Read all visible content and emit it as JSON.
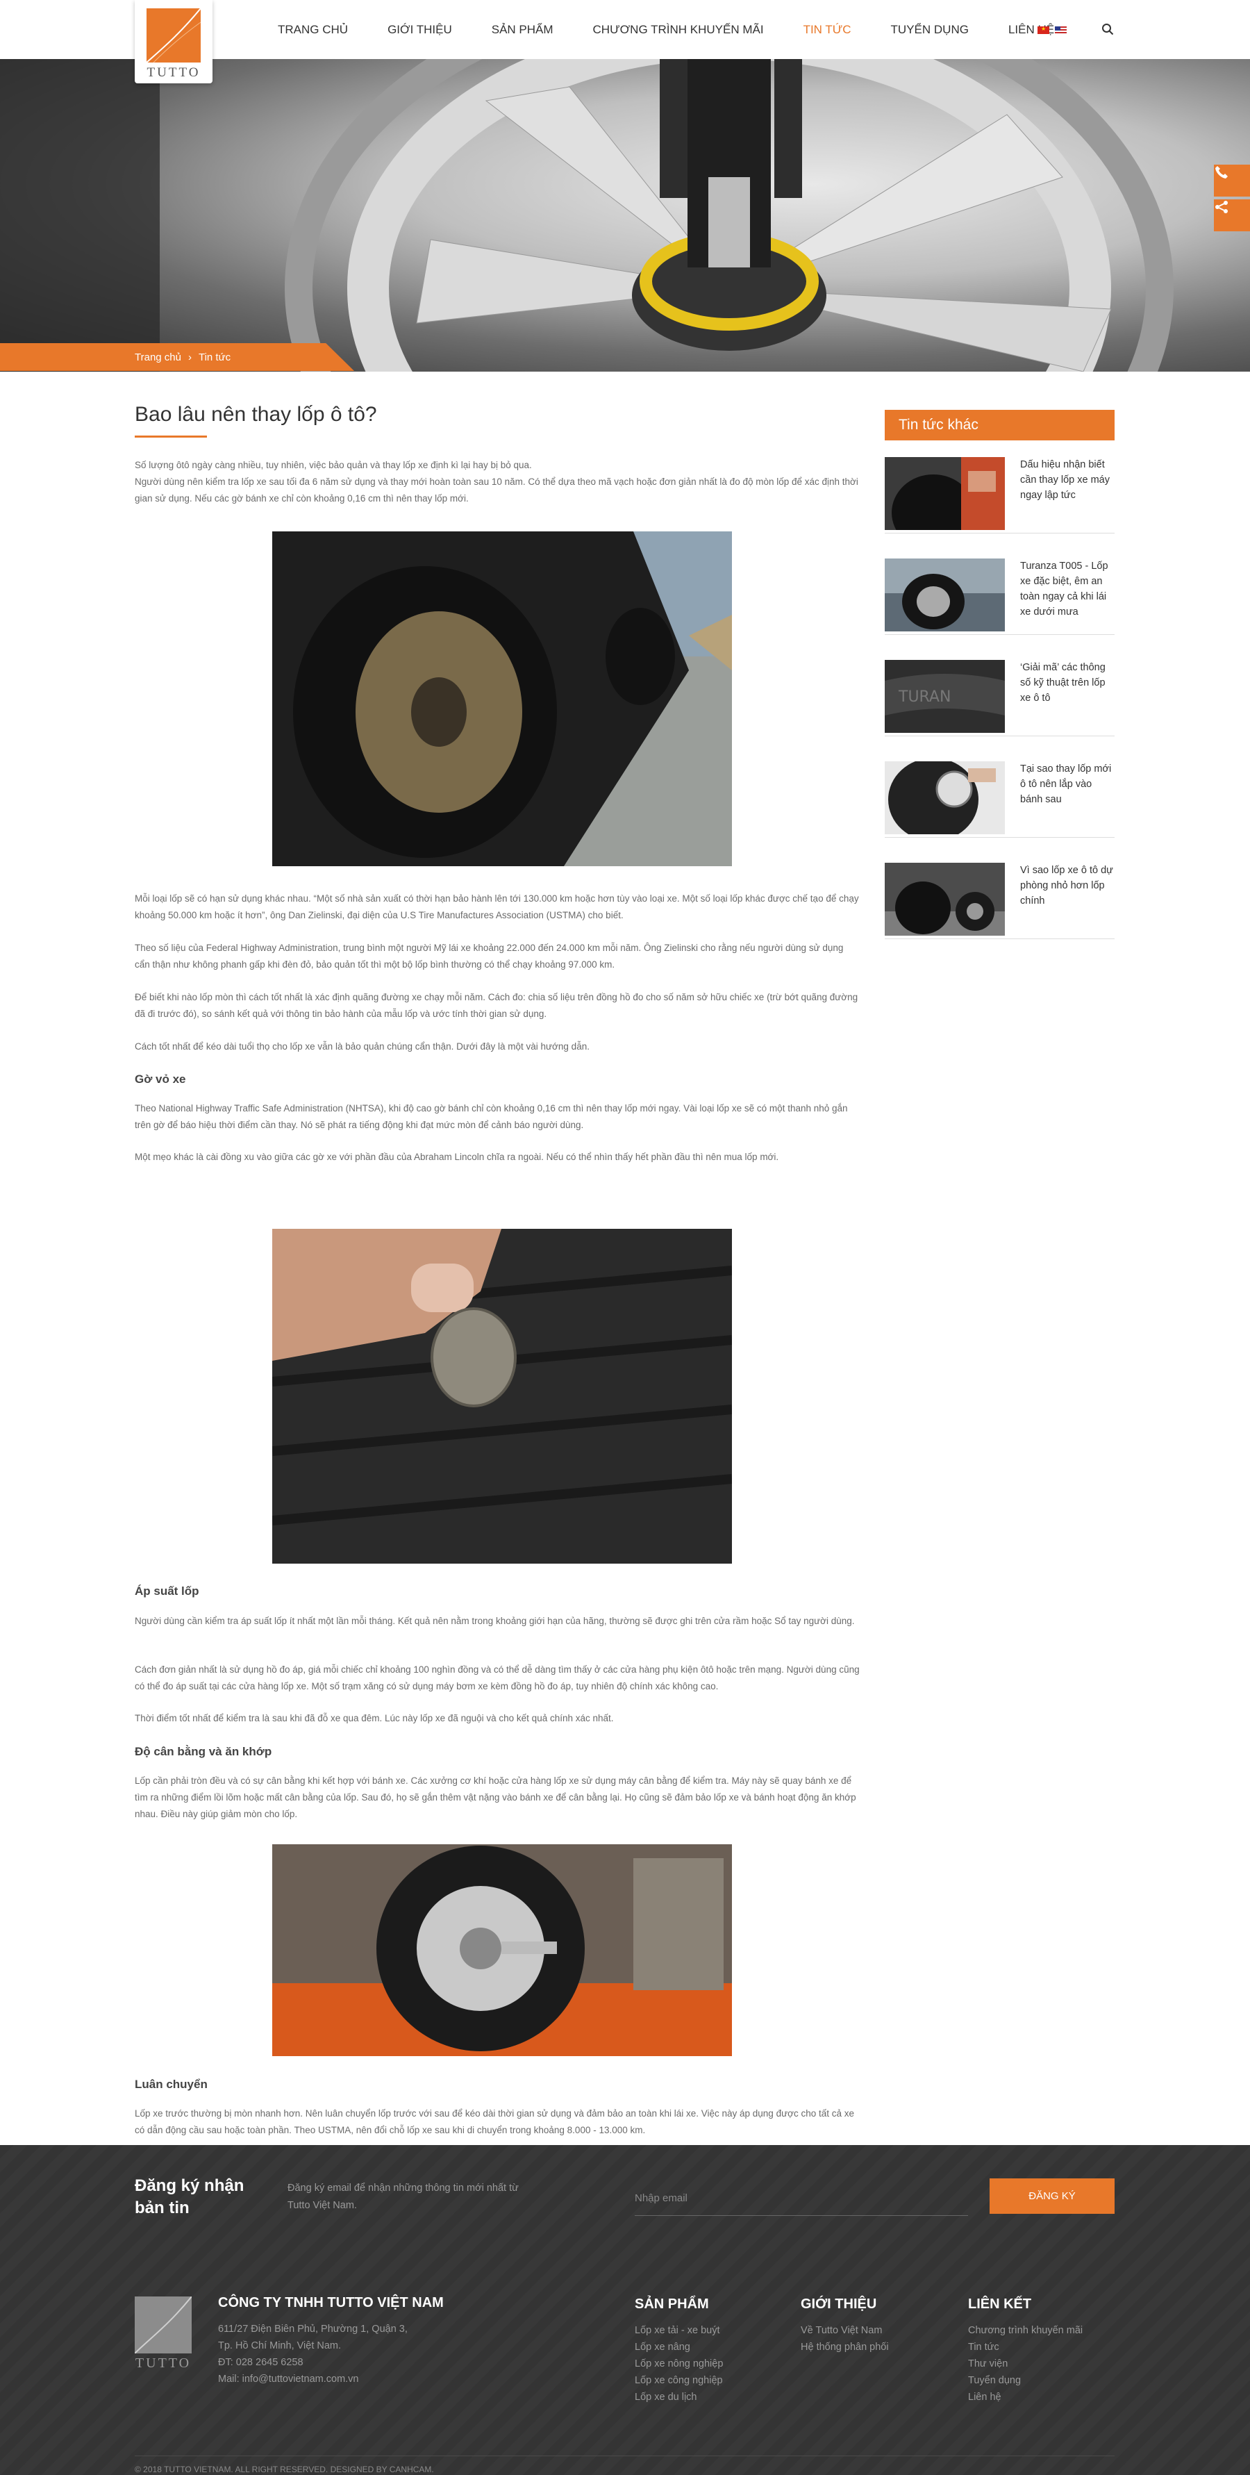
{
  "header": {
    "logo_text": "TUTTO",
    "nav": [
      {
        "label": "Trang chủ",
        "active": false
      },
      {
        "label": "Giới thiệu",
        "active": false
      },
      {
        "label": "Sản phẩm",
        "active": false
      },
      {
        "label": "Chương trình khuyến mãi",
        "active": false
      },
      {
        "label": "Tin tức",
        "active": true
      },
      {
        "label": "Tuyển dụng",
        "active": false
      },
      {
        "label": "Liên hệ",
        "active": false
      }
    ],
    "languages": [
      "vi",
      "en"
    ],
    "icons": {
      "search": "search-icon",
      "phone": "phone-icon",
      "share": "share-icon"
    }
  },
  "breadcrumb": {
    "home": "Trang chủ",
    "separator": "›",
    "current": "Tin tức"
  },
  "article": {
    "title": "Bao lâu nên thay lốp ô tô?",
    "intro": [
      "Số lượng ôtô ngày càng nhiều, tuy nhiên, việc bảo quản và thay lốp xe định kì lại hay bị bỏ qua.",
      "Người dùng nên kiểm tra lốp xe sau tối đa 6 năm sử dụng và thay mới hoàn toàn sau 10 năm. Có thể dựa theo mã vạch hoặc đơn giản nhất là đo độ mòn lốp để xác định thời gian sử dụng. Nếu các gờ bánh xe chỉ còn khoảng 0,16 cm thì nên thay lốp mới."
    ],
    "p1": "Mỗi loại lốp sẽ có hạn sử dụng khác nhau. “Một số nhà sản xuất có thời hạn bảo hành lên tới 130.000 km hoặc hơn tùy vào loại xe. Một số loại lốp khác được chế tạo để chạy khoảng 50.000 km hoặc ít hơn”, ông Dan Zielinski, đại diện của U.S Tire Manufactures Association (USTMA) cho biết.",
    "p2": "Theo số liệu của Federal Highway Administration, trung bình một người Mỹ lái xe khoảng 22.000 đến 24.000 km mỗi năm. Ông Zielinski cho rằng nếu người dùng sử dụng cẩn thận như không phanh gấp khi đèn đỏ, bảo quản tốt thì một bộ lốp bình thường có thể chạy khoảng 97.000 km.",
    "p3": "Để biết khi nào lốp mòn thì cách tốt nhất là xác định quãng đường xe chạy mỗi năm. Cách đo: chia số liệu trên đồng hồ đo cho số năm sở hữu chiếc xe (trừ bớt quãng đường đã đi trước đó), so sánh kết quả với thông tin bảo hành của mẫu lốp và ước tính thời gian sử dụng.",
    "p4": "Cách tốt nhất để kéo dài tuổi thọ cho lốp xe vẫn là bảo quản chúng cẩn thận. Dưới đây là một vài hướng dẫn.",
    "h_tread": "Gờ vỏ xe",
    "p5": "Theo National Highway Traffic Safe Administration (NHTSA), khi độ cao gờ bánh chỉ còn khoảng 0,16 cm thì nên thay lốp mới ngay. Vài loại lốp xe sẽ có một thanh nhỏ gắn trên gờ để báo hiệu thời điểm cần thay. Nó sẽ phát ra tiếng động khi đạt mức mòn để cảnh báo người dùng.",
    "p6": "Một mẹo khác là cài đồng xu vào giữa các gờ xe với phần đầu của Abraham Lincoln chĩa ra ngoài. Nếu có thể nhìn thấy hết phần đầu thì nên mua lốp mới.",
    "h_pressure": "Áp suất lốp",
    "p7": "Người dùng cần kiểm tra áp suất lốp ít nhất một lần mỗi tháng. Kết quả nên nằm trong khoảng giới hạn của hãng, thường sẽ được ghi trên cửa rầm hoặc Sổ tay người dùng.",
    "p8": "Cách đơn giản nhất là sử dụng hồ đo áp, giá mỗi chiếc chỉ khoảng 100 nghìn đồng và có thể dễ dàng tìm thấy ở các cửa hàng phụ kiện ôtô hoặc trên mạng. Người dùng cũng có thể đo áp suất tại các cửa hàng lốp xe. Một số trạm xăng có sử dụng máy bơm xe kèm đồng hồ đo áp, tuy nhiên độ chính xác không cao.",
    "p9": "Thời điểm tốt nhất để kiểm tra là sau khi đã đỗ xe qua đêm. Lúc này lốp xe đã nguội và cho kết quả chính xác nhất.",
    "h_balance": "Độ cân bằng và ăn khớp",
    "p10": "Lốp cần phải tròn đều và có sự cân bằng khi kết hợp với bánh xe. Các xưởng cơ khí hoặc cửa hàng lốp xe sử dụng máy cân bằng để kiểm tra. Máy này sẽ quay bánh xe để tìm ra những điểm lồi lõm hoặc mất cân bằng của lốp. Sau đó, họ sẽ gắn thêm vật nặng vào bánh xe để cân bằng lại. Họ cũng sẽ đảm bảo lốp xe và bánh hoạt động ăn khớp nhau. Điều này giúp giảm mòn cho lốp.",
    "h_rotation": "Luân chuyển",
    "p11": "Lốp xe trước thường bị mòn nhanh hơn. Nên luân chuyển lốp trước với sau để kéo dài thời gian sử dụng và đảm bảo an toàn khi lái xe. Việc này áp dụng được cho tất cả xe có dẫn động cầu sau hoặc toàn phần. Theo USTMA, nên đổi chỗ lốp xe sau khi di chuyển trong khoảng 8.000 - 13.000 km."
  },
  "sidebar": {
    "title": "Tin tức khác",
    "items": [
      {
        "title": "Dấu hiệu nhận biết cần thay lốp xe máy ngay lập tức"
      },
      {
        "title": "Turanza T005 - Lốp xe đặc biệt, êm an toàn ngay cả khi lái xe dưới mưa"
      },
      {
        "title": "‘Giải mã’ các thông số kỹ thuật trên lốp xe ô tô"
      },
      {
        "title": "Tại sao thay lốp mới ô tô nên lắp vào bánh sau"
      },
      {
        "title": "Vì sao lốp xe ô tô dự phòng nhỏ hơn lốp chính"
      }
    ]
  },
  "newsletter": {
    "title": "Đăng ký nhận bản tin",
    "description": "Đăng ký email để nhận những thông tin mới nhất từ Tutto Việt Nam.",
    "placeholder": "Nhập email",
    "button": "Đăng ký"
  },
  "footer": {
    "logo_text": "TUTTO",
    "company_name": "Công ty TNHH Tutto Việt Nam",
    "address_1": "611/27 Điện Biên Phủ, Phường 1, Quận 3,",
    "address_2": "Tp. Hồ Chí Minh, Việt Nam.",
    "phone": "ĐT: 028 2645 6258",
    "email": "Mail: info@tuttovietnam.com.vn",
    "columns": [
      {
        "title": "Sản phẩm",
        "links": [
          "Lốp xe tải - xe buýt",
          "Lốp xe nâng",
          "Lốp xe nông nghiệp",
          "Lốp xe công nghiệp",
          "Lốp xe du lịch"
        ]
      },
      {
        "title": "Giới thiệu",
        "links": [
          "Về Tutto Việt Nam",
          "Hệ thống phân phối"
        ]
      },
      {
        "title": "Liên kết",
        "links": [
          "Chương trình khuyến mãi",
          "Tin tức",
          "Thư viện",
          "Tuyển dụng",
          "Liên hệ"
        ]
      }
    ],
    "copyright": "© 2018 TUTTO VIETNAM. ALL RIGHT RESERVED. DESIGNED BY CANHCAM."
  },
  "colors": {
    "accent": "#e8782a",
    "footer_bg": "#363636",
    "text": "#6a6a6a"
  }
}
